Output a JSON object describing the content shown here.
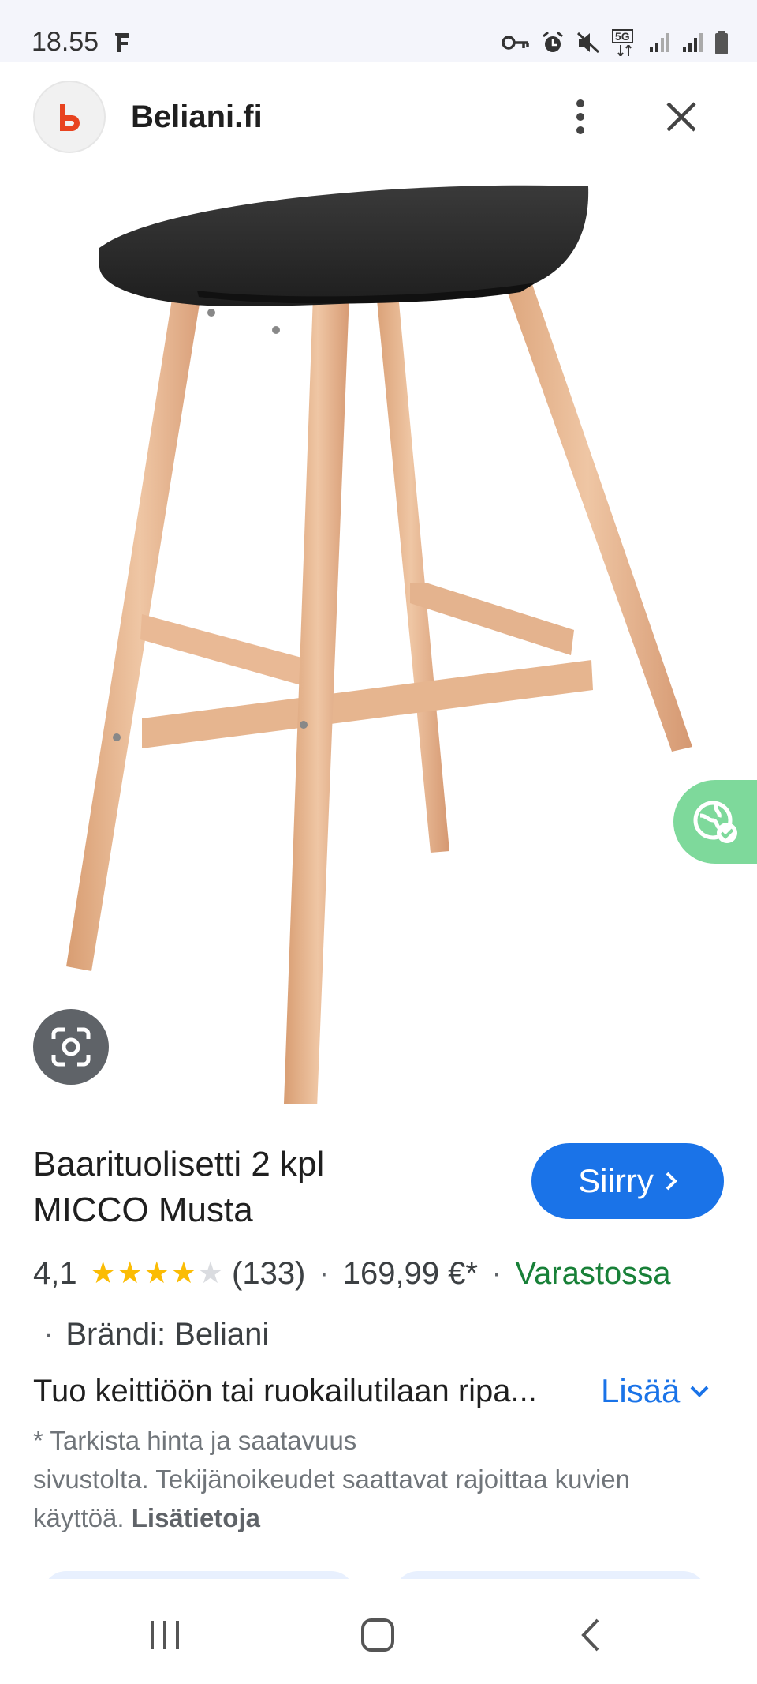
{
  "status_bar": {
    "time": "18.55",
    "network_label": "5G",
    "icons": [
      "facebook-notification-icon",
      "vpn-key-icon",
      "alarm-icon",
      "mute-icon",
      "5g-icon",
      "signal-icon",
      "signal-icon",
      "battery-icon"
    ]
  },
  "header": {
    "site_name": "Beliani.fi",
    "logo_icon": "beliani-logo-icon",
    "menu_icon": "more-vert-icon",
    "close_icon": "close-icon"
  },
  "product": {
    "image_alt": "bar-stool-image",
    "title_line1": "Baarituolisetti 2 kpl",
    "title_line2": "MICCO Musta",
    "visit_label": "Siirry",
    "rating": "4,1",
    "rating_stars": 4.1,
    "reviews": "(133)",
    "price": "169,99 €*",
    "availability": "Varastossa",
    "brand": "Brändi: Beliani",
    "description": "Tuo keittiöön tai ruokailutilaan ripa...",
    "more_label": "Lisää",
    "disclaimer_line1": "* Tarkista hinta ja saatavuus",
    "disclaimer_line2": "sivustolta. Tekijänoikeudet saattavat rajoittaa kuvien",
    "disclaimer_line3": "käyttöä.",
    "disclaimer_link": "Lisätietoja"
  },
  "colors": {
    "accent_blue": "#1a73e8",
    "stock_green": "#188038",
    "star_yellow": "#fbbc04",
    "translate_green": "#7ed99b",
    "logo_orange": "#e8431f"
  },
  "nav_bar": {
    "recents_icon": "recents-icon",
    "home_icon": "home-icon",
    "back_icon": "back-icon"
  }
}
